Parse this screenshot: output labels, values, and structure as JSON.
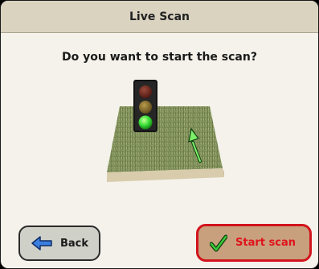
{
  "window": {
    "title": "Live Scan"
  },
  "main": {
    "prompt": "Do you want to start the scan?"
  },
  "buttons": {
    "back_label": "Back",
    "start_label": "Start scan"
  },
  "colors": {
    "titlebar": "#d9d3c0",
    "background": "#f4f2ea",
    "start_border": "#d2141c",
    "start_text": "#e0141c",
    "start_fill": "#c8a07e",
    "back_fill": "#cfd0c8",
    "arrow_blue": "#3a7fe0",
    "checkmark_green": "#1c9a1c"
  },
  "icons": {
    "back": "arrow-left-icon",
    "start": "checkmark-icon",
    "scene": "traffic-light-on-grass-field-icon",
    "direction": "direction-arrow-icon"
  }
}
